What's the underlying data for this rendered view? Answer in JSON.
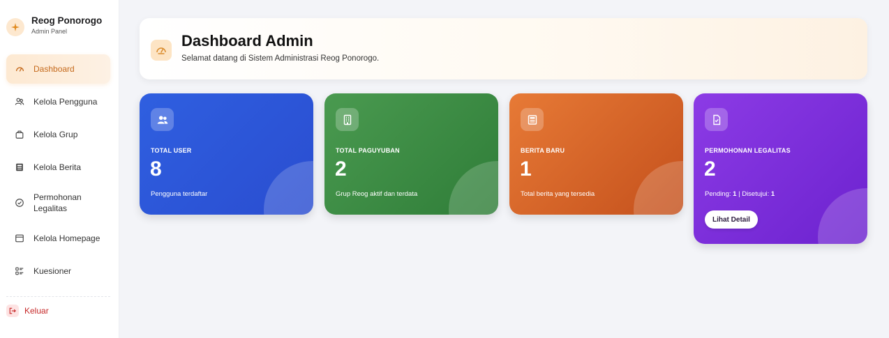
{
  "brand": {
    "title": "Reog Ponorogo",
    "subtitle": "Admin Panel",
    "icon": "sparkle-icon"
  },
  "sidebar": {
    "items": [
      {
        "label": "Dashboard",
        "icon": "gauge-icon",
        "active": true
      },
      {
        "label": "Kelola Pengguna",
        "icon": "users-icon"
      },
      {
        "label": "Kelola Grup",
        "icon": "bag-icon"
      },
      {
        "label": "Kelola Berita",
        "icon": "newspaper-icon"
      },
      {
        "label": "Permohonan Legalitas",
        "icon": "check-circle-icon"
      },
      {
        "label": "Kelola Homepage",
        "icon": "browser-icon"
      },
      {
        "label": "Kuesioner",
        "icon": "list-icon"
      }
    ],
    "logout": {
      "label": "Keluar",
      "icon": "logout-icon"
    }
  },
  "header": {
    "title": "Dashboard Admin",
    "subtitle": "Selamat datang di Sistem Administrasi Reog Ponorogo.",
    "icon": "gauge-icon"
  },
  "cards": [
    {
      "title": "TOTAL USER",
      "value": "8",
      "desc": "Pengguna terdaftar",
      "icon": "users-icon",
      "color": "#2f5fe0"
    },
    {
      "title": "TOTAL PAGUYUBAN",
      "value": "2",
      "desc": "Grup Reog aktif dan terdata",
      "icon": "building-icon",
      "color": "#4a9a50"
    },
    {
      "title": "BERITA BARU",
      "value": "1",
      "desc": "Total berita yang tersedia",
      "icon": "newspaper-icon",
      "color": "#e77a36"
    },
    {
      "title": "PERMOHONAN LEGALITAS",
      "value": "2",
      "pending_label": "Pending:",
      "pending_value": "1",
      "separator": "|",
      "approved_label": "Disetujui:",
      "approved_value": "1",
      "button": "Lihat Detail",
      "icon": "document-check-icon",
      "color": "#8c3be5"
    }
  ]
}
